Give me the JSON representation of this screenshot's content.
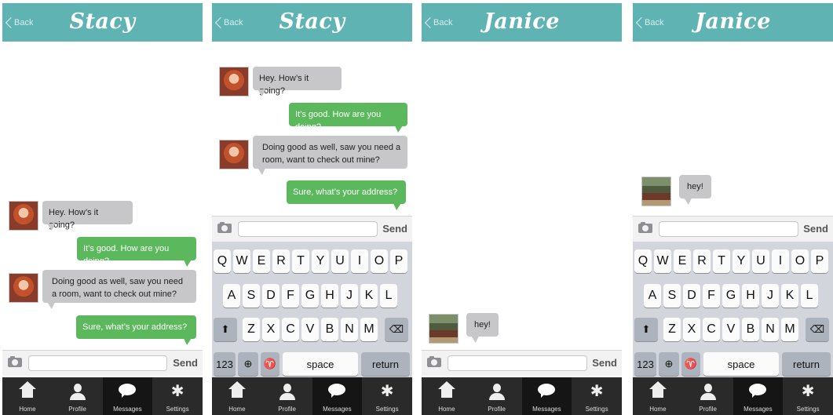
{
  "screens": [
    {
      "contact": "Stacy",
      "back_label": "Back",
      "messages": [
        {
          "from": "them",
          "text": "Hey. How’s it going?"
        },
        {
          "from": "me",
          "text": "It’s good. How are you doing?"
        },
        {
          "from": "them",
          "text": "Doing good as well, saw you need a room, want to check out mine?"
        },
        {
          "from": "me",
          "text": "Sure, what’s your address?"
        }
      ],
      "input": {
        "value": "",
        "send_label": "Send"
      },
      "keyboard_visible": false
    },
    {
      "contact": "Stacy",
      "back_label": "Back",
      "messages": [
        {
          "from": "them",
          "text": "Hey. How’s it going?"
        },
        {
          "from": "me",
          "text": "It’s good. How are you doing?"
        },
        {
          "from": "them",
          "text": "Doing good as well, saw you need a room, want to check out mine?"
        },
        {
          "from": "me",
          "text": "Sure, what’s your address?"
        }
      ],
      "input": {
        "value": "",
        "send_label": "Send"
      },
      "keyboard_visible": true
    },
    {
      "contact": "Janice",
      "back_label": "Back",
      "messages": [
        {
          "from": "them",
          "text": "hey!"
        }
      ],
      "input": {
        "value": "",
        "send_label": "Send"
      },
      "keyboard_visible": false
    },
    {
      "contact": "Janice",
      "back_label": "Back",
      "messages": [
        {
          "from": "them",
          "text": "hey!"
        }
      ],
      "input": {
        "value": "",
        "send_label": "Send"
      },
      "keyboard_visible": true
    }
  ],
  "keyboard": {
    "row1": [
      "Q",
      "W",
      "E",
      "R",
      "T",
      "Y",
      "U",
      "I",
      "O",
      "P"
    ],
    "row2": [
      "A",
      "S",
      "D",
      "F",
      "G",
      "H",
      "J",
      "K",
      "L"
    ],
    "row3": [
      "Z",
      "X",
      "C",
      "V",
      "B",
      "N",
      "M"
    ],
    "numbers_label": "123",
    "space_label": "space",
    "return_label": "return",
    "shift_icon": "shift-arrow-icon",
    "delete_icon": "backspace-icon",
    "globe_icon": "globe-icon",
    "mic_icon": "microphone-icon"
  },
  "tabs": [
    {
      "label": "Home",
      "icon": "home-icon"
    },
    {
      "label": "Profile",
      "icon": "person-icon"
    },
    {
      "label": "Messages",
      "icon": "speech-bubble-icon"
    },
    {
      "label": "Settings",
      "icon": "gear-icon"
    }
  ],
  "active_tab": "Messages",
  "colors": {
    "header": "#5fb3b3",
    "sent_bubble": "#5cb85c",
    "received_bubble": "#c7c7c9",
    "tabbar": "#2a2a2a"
  }
}
